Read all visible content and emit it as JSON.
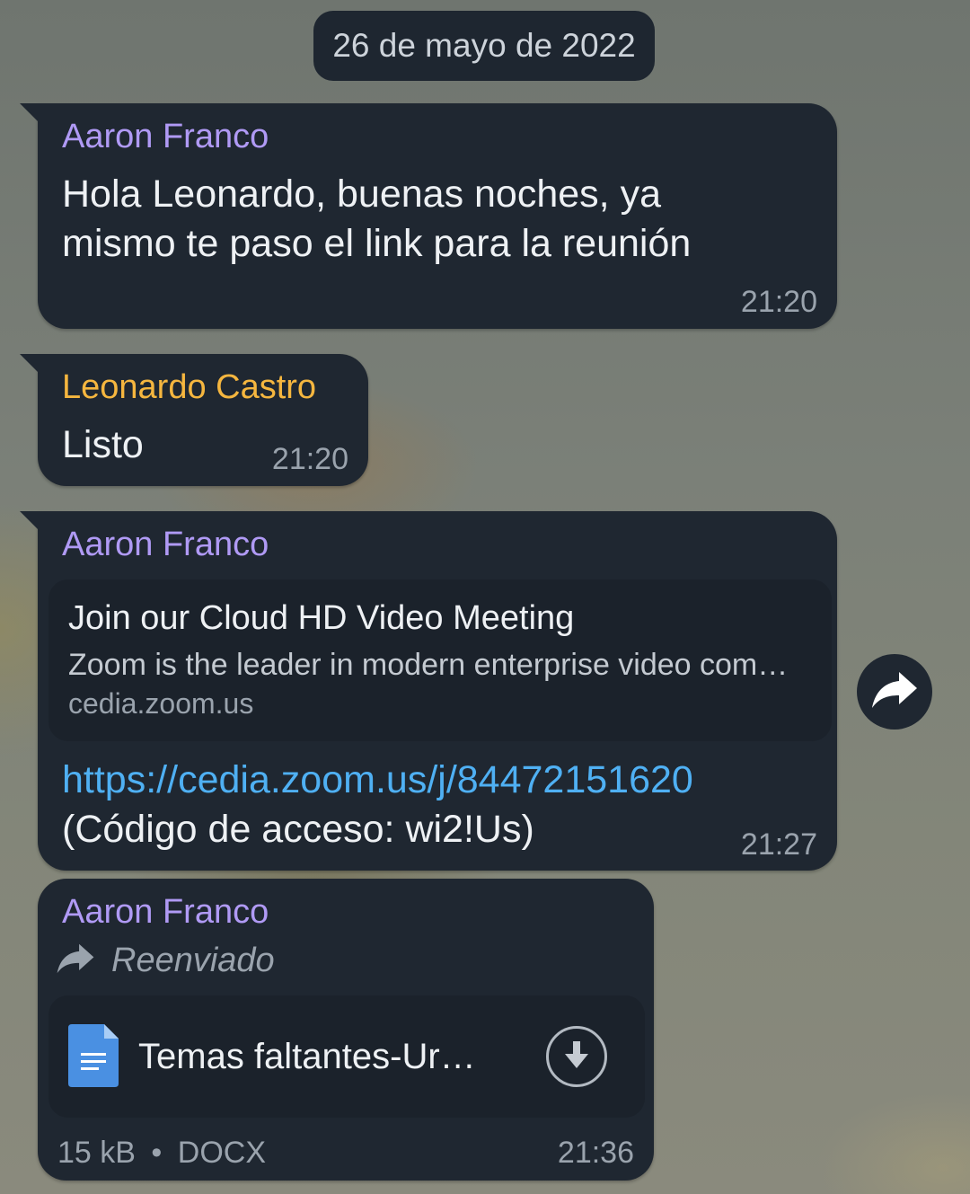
{
  "date_separator": "26 de mayo de 2022",
  "messages": [
    {
      "sender": "Aaron Franco",
      "text_line1": "Hola Leonardo, buenas noches, ya",
      "text_line2": "mismo te paso el link para la reunión",
      "time": "21:20"
    },
    {
      "sender": "Leonardo Castro",
      "text": "Listo",
      "time": "21:20"
    },
    {
      "sender": "Aaron Franco",
      "preview": {
        "title": "Join our Cloud HD Video Meeting",
        "description": "Zoom is the leader in modern enterprise video com…",
        "domain": "cedia.zoom.us"
      },
      "link": "https://cedia.zoom.us/j/84472151620",
      "text": "(Código de acceso: wi2!Us)",
      "time": "21:27"
    },
    {
      "sender": "Aaron Franco",
      "forwarded_label": "Reenviado",
      "file_name": "Temas faltantes-Ur…",
      "file_size": "15 kB",
      "file_type": "DOCX",
      "meta_separator": "•",
      "time": "21:36"
    }
  ],
  "icons": {
    "share": "share-arrow-icon",
    "forward": "forward-arrow-icon",
    "document": "document-icon",
    "download": "download-icon"
  },
  "colors": {
    "bubble": "#1f2731",
    "sender_a": "#b09af5",
    "sender_b": "#f5b63f",
    "link": "#4fb0f3",
    "file_icon": "#4a90e2"
  }
}
